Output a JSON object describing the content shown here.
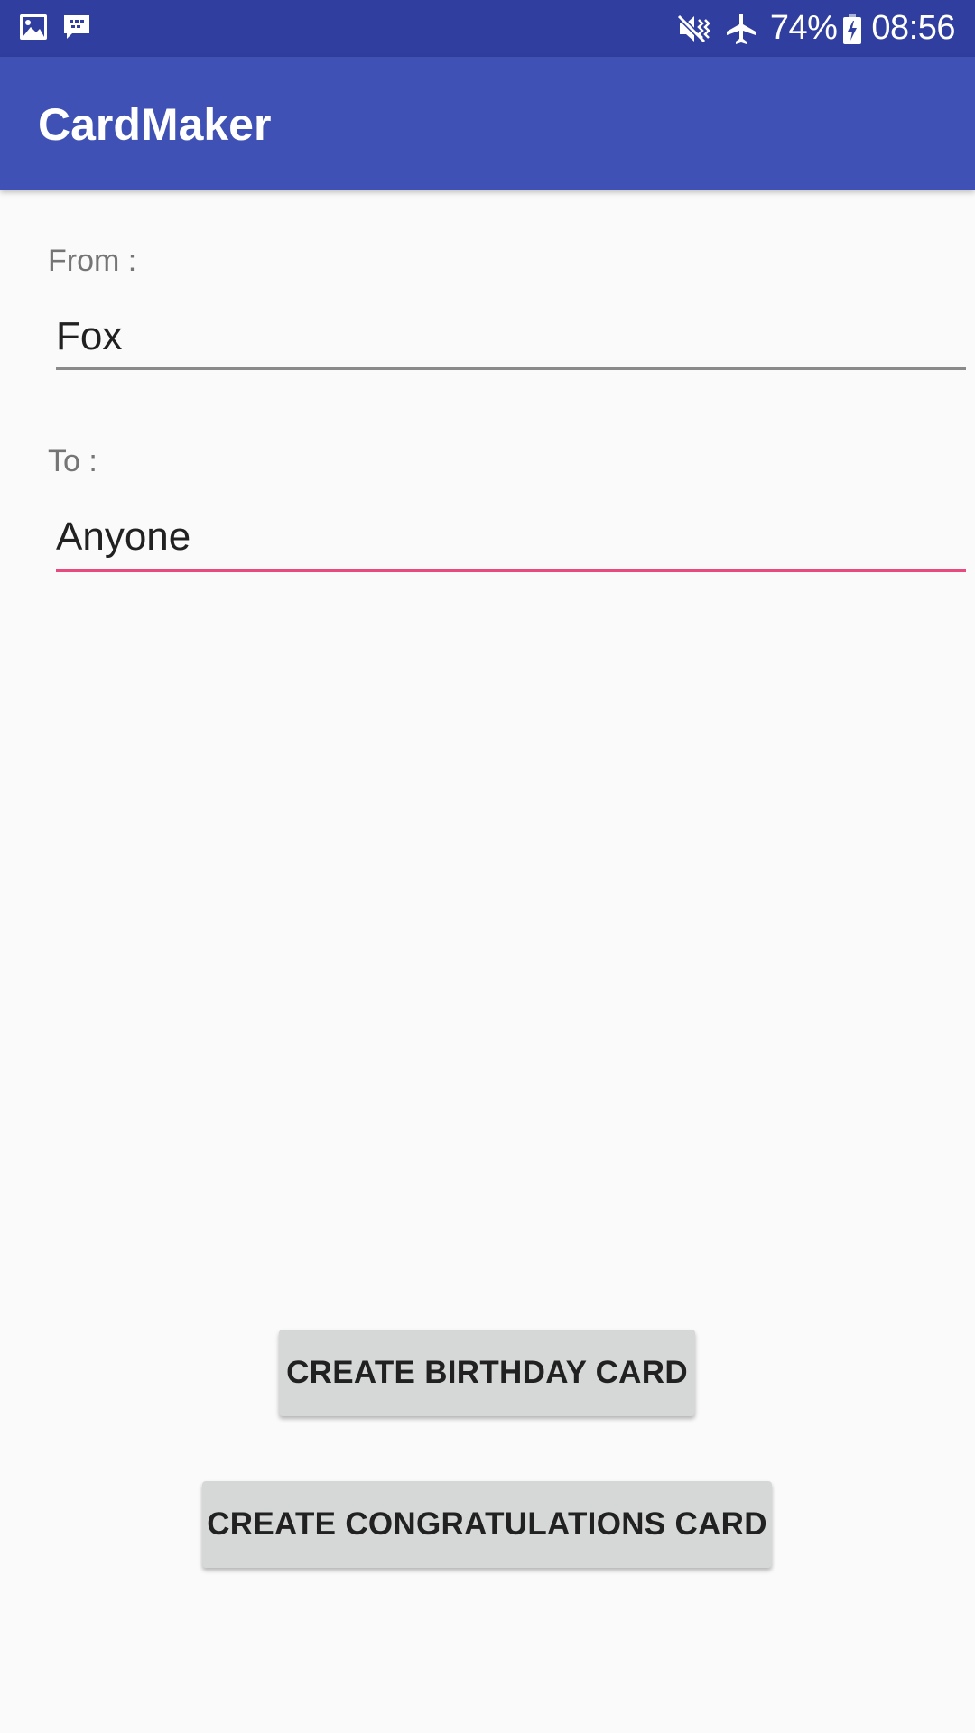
{
  "status_bar": {
    "left_icons": [
      "image-icon",
      "bbm-icon"
    ],
    "right_icons": [
      "vibrate-mute-icon",
      "airplane-mode-icon",
      "battery-charging-icon"
    ],
    "battery": "74%",
    "time": "08:56"
  },
  "app_bar": {
    "title": "CardMaker",
    "color": "#3f51b5",
    "status_color": "#303f9f"
  },
  "form": {
    "from_label": "From :",
    "from_value": "Fox",
    "to_label": "To :",
    "to_value": "Anyone",
    "focused_field": "to",
    "accent_color": "#e84a7e"
  },
  "actions": {
    "birthday_label": "CREATE BIRTHDAY CARD",
    "congratulations_label": "CREATE CONGRATULATIONS CARD"
  }
}
